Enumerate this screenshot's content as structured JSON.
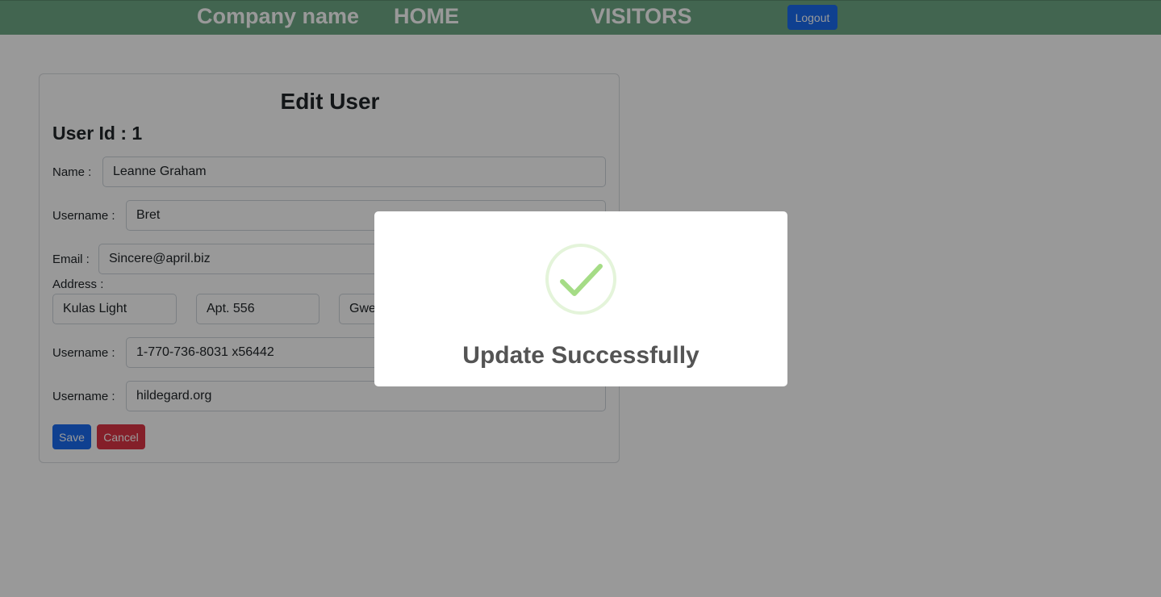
{
  "navbar": {
    "brand": "Company name",
    "home": "HOME",
    "visitors": "VISITORS",
    "logout": "Logout"
  },
  "form": {
    "title": "Edit User",
    "user_id": "User Id : 1",
    "name_label": "Name :",
    "name_value": "Leanne Graham",
    "username_label": "Username :",
    "username_value": "Bret",
    "email_label": "Email :",
    "email_value": "Sincere@april.biz",
    "address_label": "Address :",
    "address_street": "Kulas Light",
    "address_suite": "Apt. 556",
    "address_city": "Gwe",
    "phone_label": "Username :",
    "phone_value": "1-770-736-8031 x56442",
    "website_label": "Username :",
    "website_value": "hildegard.org",
    "save": "Save",
    "cancel": "Cancel"
  },
  "modal": {
    "title": "Update Successfully",
    "icon": "success-check-icon",
    "icon_color": "#a5dc86"
  }
}
